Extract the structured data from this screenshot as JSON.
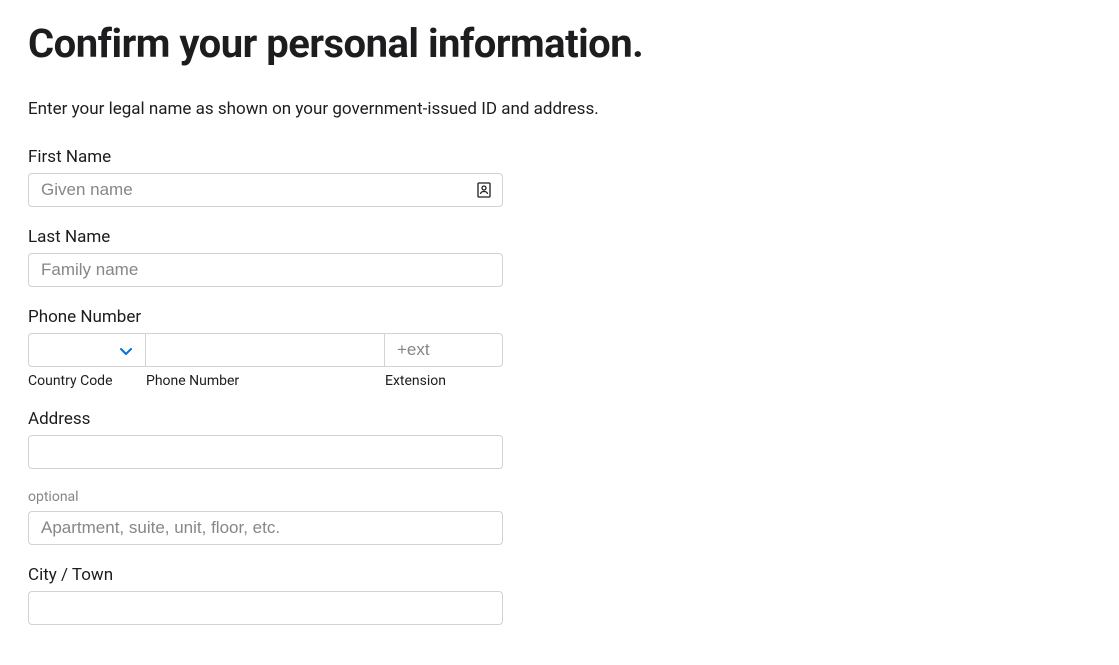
{
  "title": "Confirm your personal information.",
  "subtitle": "Enter your legal name as shown on your government-issued ID and address.",
  "fields": {
    "first_name": {
      "label": "First Name",
      "placeholder": "Given name",
      "value": ""
    },
    "last_name": {
      "label": "Last Name",
      "placeholder": "Family name",
      "value": ""
    },
    "phone": {
      "label": "Phone Number",
      "country_code": {
        "value": "",
        "sublabel": "Country Code"
      },
      "number": {
        "value": "",
        "placeholder": "",
        "sublabel": "Phone Number"
      },
      "extension": {
        "value": "",
        "placeholder": "+ext",
        "sublabel": "Extension"
      }
    },
    "address": {
      "label": "Address",
      "value": "",
      "placeholder": ""
    },
    "address2": {
      "label": "optional",
      "placeholder": "Apartment, suite, unit, floor, etc.",
      "value": ""
    },
    "city": {
      "label": "City / Town",
      "value": "",
      "placeholder": ""
    }
  }
}
